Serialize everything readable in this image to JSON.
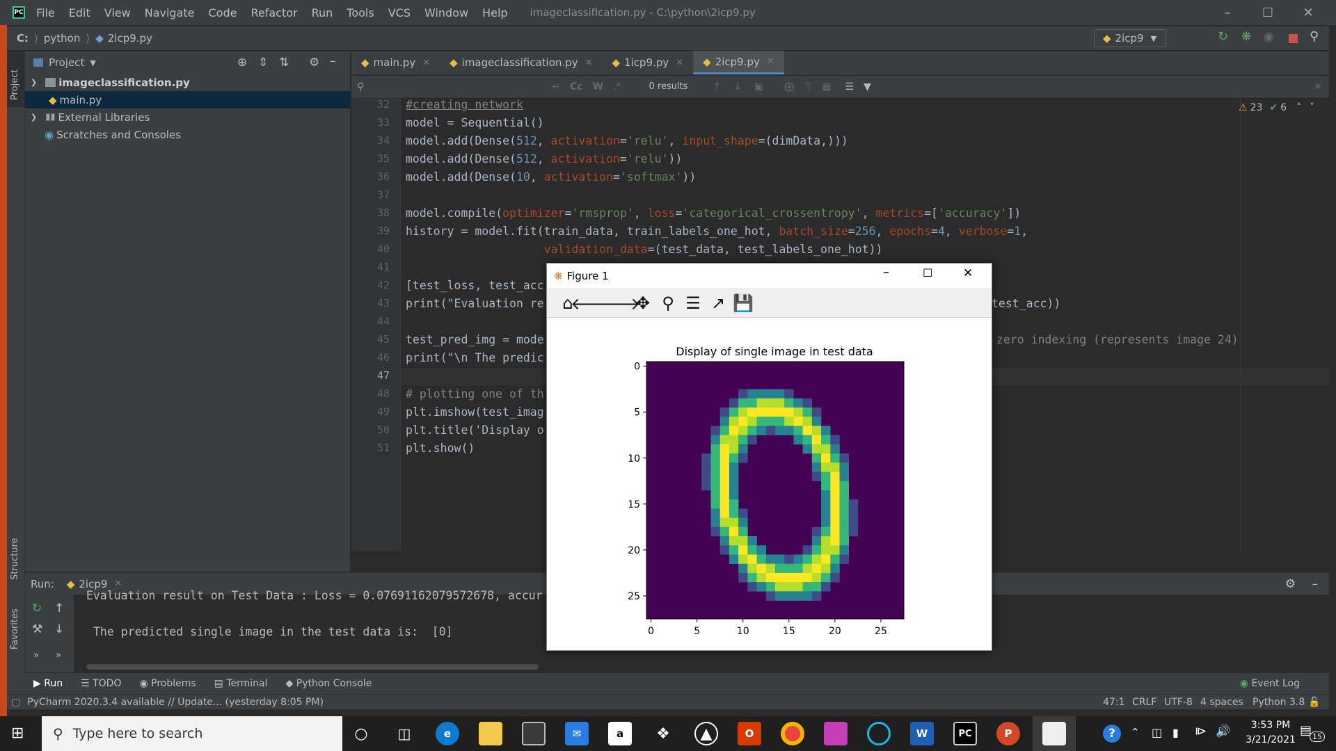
{
  "window": {
    "title": "imageclassification.py - C:\\python\\2icp9.py",
    "menu": [
      "File",
      "Edit",
      "View",
      "Navigate",
      "Code",
      "Refactor",
      "Run",
      "Tools",
      "VCS",
      "Window",
      "Help"
    ]
  },
  "navbar": {
    "crumbs": [
      "C:",
      "python",
      "2icp9.py"
    ],
    "run_config": "2icp9"
  },
  "stripe": {
    "project": "Project",
    "structure": "Structure",
    "favorites": "Favorites"
  },
  "project": {
    "header": "Project",
    "items": [
      {
        "label": "imageclassification.py"
      },
      {
        "label": "main.py"
      },
      {
        "label": "External Libraries"
      },
      {
        "label": "Scratches and Consoles"
      }
    ]
  },
  "tabs": [
    "main.py",
    "imageclassification.py",
    "1icp9.py",
    "2icp9.py"
  ],
  "findbar": {
    "results": "0 results",
    "cc": "Cc",
    "w": "W",
    "star": ".*"
  },
  "inspections": {
    "warnings": "23",
    "checks": "6"
  },
  "code": {
    "line_numbers": [
      "32",
      "33",
      "34",
      "35",
      "36",
      "37",
      "38",
      "39",
      "40",
      "41",
      "42",
      "43",
      "44",
      "45",
      "46",
      "47",
      "48",
      "49",
      "50",
      "51"
    ],
    "lines": [
      "#creating network",
      "model = Sequential()",
      "model.add(Dense(512, activation='relu', input_shape=(dimData,)))",
      "model.add(Dense(512, activation='relu'))",
      "model.add(Dense(10, activation='softmax'))",
      "",
      "model.compile(optimizer='rmsprop', loss='categorical_crossentropy', metrics=['accuracy'])",
      "history = model.fit(train_data, train_labels_one_hot, batch_size=256, epochs=4, verbose=1,",
      "                    validation_data=(test_data, test_labels_one_hot))",
      "",
      "[test_loss, test_acc",
      "print(\"Evaluation re",
      "",
      "test_pred_img = mode",
      "print(\"\\n The predic",
      "",
      "# plotting one of th",
      "plt.imshow(test_imag",
      "plt.title('Display o",
      "plt.show()"
    ],
    "line43_tail": "test_acc))",
    "line45_tail": "zero indexing (represents image 24)"
  },
  "run": {
    "label": "Run:",
    "tab": "2icp9",
    "output_line1": "Evaluation result on Test Data : Loss = 0.07691162079572678, accur",
    "output_line2": "The predicted single image in the test data is:  [0]"
  },
  "bottom_tabs": [
    "Run",
    "TODO",
    "Problems",
    "Terminal",
    "Python Console"
  ],
  "event_log": "Event Log",
  "status": {
    "message": "PyCharm 2020.3.4 available // Update... (yesterday 8:05 PM)",
    "position": "47:1",
    "line_sep": "CRLF",
    "encoding": "UTF-8",
    "indent": "4 spaces",
    "interpreter": "Python 3.8"
  },
  "figure": {
    "title": "Figure 1",
    "plot_title": "Display of single image in test data"
  },
  "chart_data": {
    "type": "heatmap",
    "title": "Display of single image in test data",
    "x_ticks": [
      "0",
      "5",
      "10",
      "15",
      "20",
      "25"
    ],
    "y_ticks": [
      "0",
      "5",
      "10",
      "15",
      "20",
      "25"
    ],
    "colormap": "viridis",
    "size": [
      28,
      28
    ],
    "depicts": "handwritten digit 0"
  },
  "taskbar": {
    "search_placeholder": "Type here to search",
    "time": "3:53 PM",
    "date": "3/21/2021",
    "notifications": "15"
  }
}
